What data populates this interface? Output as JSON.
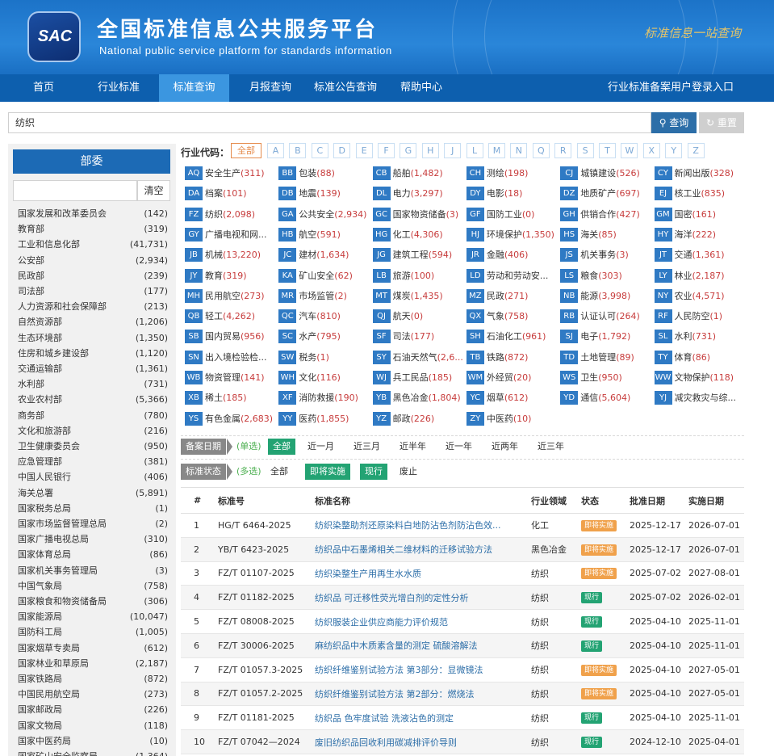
{
  "header": {
    "logo_text": "SAC",
    "title_cn": "全国标准信息公共服务平台",
    "title_en": "National public service platform  for standards information",
    "slogan": "标准信息一站查询"
  },
  "nav": {
    "items": [
      "首页",
      "行业标准",
      "标准查询",
      "月报查询",
      "标准公告查询",
      "帮助中心"
    ],
    "active_index": 2,
    "login": "行业标准备案用户登录入口"
  },
  "search": {
    "value": "纺织",
    "query_label": "查询",
    "reset_label": "重置"
  },
  "sidebar": {
    "title": "部委",
    "clear_label": "清空",
    "items": [
      {
        "name": "国家发展和改革委员会",
        "count": "(142)"
      },
      {
        "name": "教育部",
        "count": "(319)"
      },
      {
        "name": "工业和信息化部",
        "count": "(41,731)"
      },
      {
        "name": "公安部",
        "count": "(2,934)"
      },
      {
        "name": "民政部",
        "count": "(239)"
      },
      {
        "name": "司法部",
        "count": "(177)"
      },
      {
        "name": "人力资源和社会保障部",
        "count": "(213)"
      },
      {
        "name": "自然资源部",
        "count": "(1,206)"
      },
      {
        "name": "生态环境部",
        "count": "(1,350)"
      },
      {
        "name": "住房和城乡建设部",
        "count": "(1,120)"
      },
      {
        "name": "交通运输部",
        "count": "(1,361)"
      },
      {
        "name": "水利部",
        "count": "(731)"
      },
      {
        "name": "农业农村部",
        "count": "(5,366)"
      },
      {
        "name": "商务部",
        "count": "(780)"
      },
      {
        "name": "文化和旅游部",
        "count": "(216)"
      },
      {
        "name": "卫生健康委员会",
        "count": "(950)"
      },
      {
        "name": "应急管理部",
        "count": "(381)"
      },
      {
        "name": "中国人民银行",
        "count": "(406)"
      },
      {
        "name": "海关总署",
        "count": "(5,891)"
      },
      {
        "name": "国家税务总局",
        "count": "(1)"
      },
      {
        "name": "国家市场监督管理总局",
        "count": "(2)"
      },
      {
        "name": "国家广播电视总局",
        "count": "(310)"
      },
      {
        "name": "国家体育总局",
        "count": "(86)"
      },
      {
        "name": "国家机关事务管理局",
        "count": "(3)"
      },
      {
        "name": "中国气象局",
        "count": "(758)"
      },
      {
        "name": "国家粮食和物资储备局",
        "count": "(306)"
      },
      {
        "name": "国家能源局",
        "count": "(10,047)"
      },
      {
        "name": "国防科工局",
        "count": "(1,005)"
      },
      {
        "name": "国家烟草专卖局",
        "count": "(612)"
      },
      {
        "name": "国家林业和草原局",
        "count": "(2,187)"
      },
      {
        "name": "国家铁路局",
        "count": "(872)"
      },
      {
        "name": "中国民用航空局",
        "count": "(273)"
      },
      {
        "name": "国家邮政局",
        "count": "(226)"
      },
      {
        "name": "国家文物局",
        "count": "(118)"
      },
      {
        "name": "国家中医药局",
        "count": "(10)"
      },
      {
        "name": "国家矿山安全监察局",
        "count": "(1,364)"
      }
    ]
  },
  "industry": {
    "label": "行业代码：",
    "all_label": "全部",
    "letters": [
      "A",
      "B",
      "C",
      "D",
      "E",
      "F",
      "G",
      "H",
      "J",
      "L",
      "M",
      "N",
      "Q",
      "R",
      "S",
      "T",
      "W",
      "X",
      "Y",
      "Z"
    ],
    "codes": [
      {
        "code": "AQ",
        "name": "安全生产",
        "count": "(311)"
      },
      {
        "code": "BB",
        "name": "包装",
        "count": "(88)"
      },
      {
        "code": "CB",
        "name": "船舶",
        "count": "(1,482)"
      },
      {
        "code": "CH",
        "name": "测绘",
        "count": "(198)"
      },
      {
        "code": "CJ",
        "name": "城镇建设",
        "count": "(526)"
      },
      {
        "code": "CY",
        "name": "新闻出版",
        "count": "(328)"
      },
      {
        "code": "DA",
        "name": "档案",
        "count": "(101)"
      },
      {
        "code": "DB",
        "name": "地震",
        "count": "(139)"
      },
      {
        "code": "DL",
        "name": "电力",
        "count": "(3,297)"
      },
      {
        "code": "DY",
        "name": "电影",
        "count": "(18)"
      },
      {
        "code": "DZ",
        "name": "地质矿产",
        "count": "(697)"
      },
      {
        "code": "EJ",
        "name": "核工业",
        "count": "(835)"
      },
      {
        "code": "FZ",
        "name": "纺织",
        "count": "(2,098)"
      },
      {
        "code": "GA",
        "name": "公共安全",
        "count": "(2,934)"
      },
      {
        "code": "GC",
        "name": "国家物资储备",
        "count": "(3)"
      },
      {
        "code": "GF",
        "name": "国防工业",
        "count": "(0)"
      },
      {
        "code": "GH",
        "name": "供销合作",
        "count": "(427)"
      },
      {
        "code": "GM",
        "name": "国密",
        "count": "(161)"
      },
      {
        "code": "GY",
        "name": "广播电视和网...",
        "count": ""
      },
      {
        "code": "HB",
        "name": "航空",
        "count": "(591)"
      },
      {
        "code": "HG",
        "name": "化工",
        "count": "(4,306)"
      },
      {
        "code": "HJ",
        "name": "环境保护",
        "count": "(1,350)"
      },
      {
        "code": "HS",
        "name": "海关",
        "count": "(85)"
      },
      {
        "code": "HY",
        "name": "海洋",
        "count": "(222)"
      },
      {
        "code": "JB",
        "name": "机械",
        "count": "(13,220)"
      },
      {
        "code": "JC",
        "name": "建材",
        "count": "(1,634)"
      },
      {
        "code": "JG",
        "name": "建筑工程",
        "count": "(594)"
      },
      {
        "code": "JR",
        "name": "金融",
        "count": "(406)"
      },
      {
        "code": "JS",
        "name": "机关事务",
        "count": "(3)"
      },
      {
        "code": "JT",
        "name": "交通",
        "count": "(1,361)"
      },
      {
        "code": "JY",
        "name": "教育",
        "count": "(319)"
      },
      {
        "code": "KA",
        "name": "矿山安全",
        "count": "(62)"
      },
      {
        "code": "LB",
        "name": "旅游",
        "count": "(100)"
      },
      {
        "code": "LD",
        "name": "劳动和劳动安...",
        "count": ""
      },
      {
        "code": "LS",
        "name": "粮食",
        "count": "(303)"
      },
      {
        "code": "LY",
        "name": "林业",
        "count": "(2,187)"
      },
      {
        "code": "MH",
        "name": "民用航空",
        "count": "(273)"
      },
      {
        "code": "MR",
        "name": "市场监管",
        "count": "(2)"
      },
      {
        "code": "MT",
        "name": "煤炭",
        "count": "(1,435)"
      },
      {
        "code": "MZ",
        "name": "民政",
        "count": "(271)"
      },
      {
        "code": "NB",
        "name": "能源",
        "count": "(3,998)"
      },
      {
        "code": "NY",
        "name": "农业",
        "count": "(4,571)"
      },
      {
        "code": "QB",
        "name": "轻工",
        "count": "(4,262)"
      },
      {
        "code": "QC",
        "name": "汽车",
        "count": "(810)"
      },
      {
        "code": "QJ",
        "name": "航天",
        "count": "(0)"
      },
      {
        "code": "QX",
        "name": "气象",
        "count": "(758)"
      },
      {
        "code": "RB",
        "name": "认证认可",
        "count": "(264)"
      },
      {
        "code": "RF",
        "name": "人民防空",
        "count": "(1)"
      },
      {
        "code": "SB",
        "name": "国内贸易",
        "count": "(956)"
      },
      {
        "code": "SC",
        "name": "水产",
        "count": "(795)"
      },
      {
        "code": "SF",
        "name": "司法",
        "count": "(177)"
      },
      {
        "code": "SH",
        "name": "石油化工",
        "count": "(961)"
      },
      {
        "code": "SJ",
        "name": "电子",
        "count": "(1,792)"
      },
      {
        "code": "SL",
        "name": "水利",
        "count": "(731)"
      },
      {
        "code": "SN",
        "name": "出入境检验检...",
        "count": ""
      },
      {
        "code": "SW",
        "name": "税务",
        "count": "(1)"
      },
      {
        "code": "SY",
        "name": "石油天然气",
        "count": "(2,6..."
      },
      {
        "code": "TB",
        "name": "铁路",
        "count": "(872)"
      },
      {
        "code": "TD",
        "name": "土地管理",
        "count": "(89)"
      },
      {
        "code": "TY",
        "name": "体育",
        "count": "(86)"
      },
      {
        "code": "WB",
        "name": "物资管理",
        "count": "(141)"
      },
      {
        "code": "WH",
        "name": "文化",
        "count": "(116)"
      },
      {
        "code": "WJ",
        "name": "兵工民品",
        "count": "(185)"
      },
      {
        "code": "WM",
        "name": "外经贸",
        "count": "(20)"
      },
      {
        "code": "WS",
        "name": "卫生",
        "count": "(950)"
      },
      {
        "code": "WW",
        "name": "文物保护",
        "count": "(118)"
      },
      {
        "code": "XB",
        "name": "稀土",
        "count": "(185)"
      },
      {
        "code": "XF",
        "name": "消防救援",
        "count": "(190)"
      },
      {
        "code": "YB",
        "name": "黑色冶金",
        "count": "(1,804)"
      },
      {
        "code": "YC",
        "name": "烟草",
        "count": "(612)"
      },
      {
        "code": "YD",
        "name": "通信",
        "count": "(5,604)"
      },
      {
        "code": "YJ",
        "name": "减灾救灾与综...",
        "count": ""
      },
      {
        "code": "YS",
        "name": "有色金属",
        "count": "(2,683)"
      },
      {
        "code": "YY",
        "name": "医药",
        "count": "(1,855)"
      },
      {
        "code": "YZ",
        "name": "邮政",
        "count": "(226)"
      },
      {
        "code": "ZY",
        "name": "中医药",
        "count": "(10)"
      }
    ]
  },
  "filters": {
    "date": {
      "tag": "备案日期",
      "hint": "(单选)",
      "options": [
        "全部",
        "近一月",
        "近三月",
        "近半年",
        "近一年",
        "近两年",
        "近三年"
      ],
      "active": [
        0
      ]
    },
    "status": {
      "tag": "标准状态",
      "hint": "(多选)",
      "options": [
        "全部",
        "即将实施",
        "现行",
        "废止"
      ],
      "active": [
        1,
        2
      ]
    }
  },
  "table": {
    "headers": [
      "#",
      "标准号",
      "标准名称",
      "行业领域",
      "状态",
      "批准日期",
      "实施日期"
    ],
    "rows": [
      {
        "no": "1",
        "code": "HG/T 6464-2025",
        "name": "纺织染整助剂还原染料白地防沾色剂防沾色效...",
        "field": "化工",
        "status": "即将实施",
        "approve": "2025-12-17",
        "impl": "2026-07-01"
      },
      {
        "no": "2",
        "code": "YB/T 6423-2025",
        "name": "纺织品中石墨烯相关二维材料的迁移试验方法",
        "field": "黑色冶金",
        "status": "即将实施",
        "approve": "2025-12-17",
        "impl": "2026-07-01"
      },
      {
        "no": "3",
        "code": "FZ/T 01107-2025",
        "name": "纺织染整生产用再生水水质",
        "field": "纺织",
        "status": "即将实施",
        "approve": "2025-07-02",
        "impl": "2027-08-01"
      },
      {
        "no": "4",
        "code": "FZ/T 01182-2025",
        "name": "纺织品 可迁移性荧光增白剂的定性分析",
        "field": "纺织",
        "status": "现行",
        "approve": "2025-07-02",
        "impl": "2026-02-01"
      },
      {
        "no": "5",
        "code": "FZ/T 08008-2025",
        "name": "纺织服装企业供应商能力评价规范",
        "field": "纺织",
        "status": "现行",
        "approve": "2025-04-10",
        "impl": "2025-11-01"
      },
      {
        "no": "6",
        "code": "FZ/T 30006-2025",
        "name": "麻纺织品中木质素含量的测定 硫酸溶解法",
        "field": "纺织",
        "status": "现行",
        "approve": "2025-04-10",
        "impl": "2025-11-01"
      },
      {
        "no": "7",
        "code": "FZ/T 01057.3-2025",
        "name": "纺织纤维鉴别试验方法 第3部分：显微镜法",
        "field": "纺织",
        "status": "即将实施",
        "approve": "2025-04-10",
        "impl": "2027-05-01"
      },
      {
        "no": "8",
        "code": "FZ/T 01057.2-2025",
        "name": "纺织纤维鉴别试验方法 第2部分：燃烧法",
        "field": "纺织",
        "status": "即将实施",
        "approve": "2025-04-10",
        "impl": "2027-05-01"
      },
      {
        "no": "9",
        "code": "FZ/T 01181-2025",
        "name": "纺织品 色牢度试验 洗液沾色的测定",
        "field": "纺织",
        "status": "现行",
        "approve": "2025-04-10",
        "impl": "2025-11-01"
      },
      {
        "no": "10",
        "code": "FZ/T 07042—2024",
        "name": "废旧纺织品回收利用碳减排评价导则",
        "field": "纺织",
        "status": "现行",
        "approve": "2024-12-10",
        "impl": "2025-04-01"
      }
    ]
  },
  "colors": {
    "upcoming": "#f0a14b",
    "current": "#23a373"
  }
}
